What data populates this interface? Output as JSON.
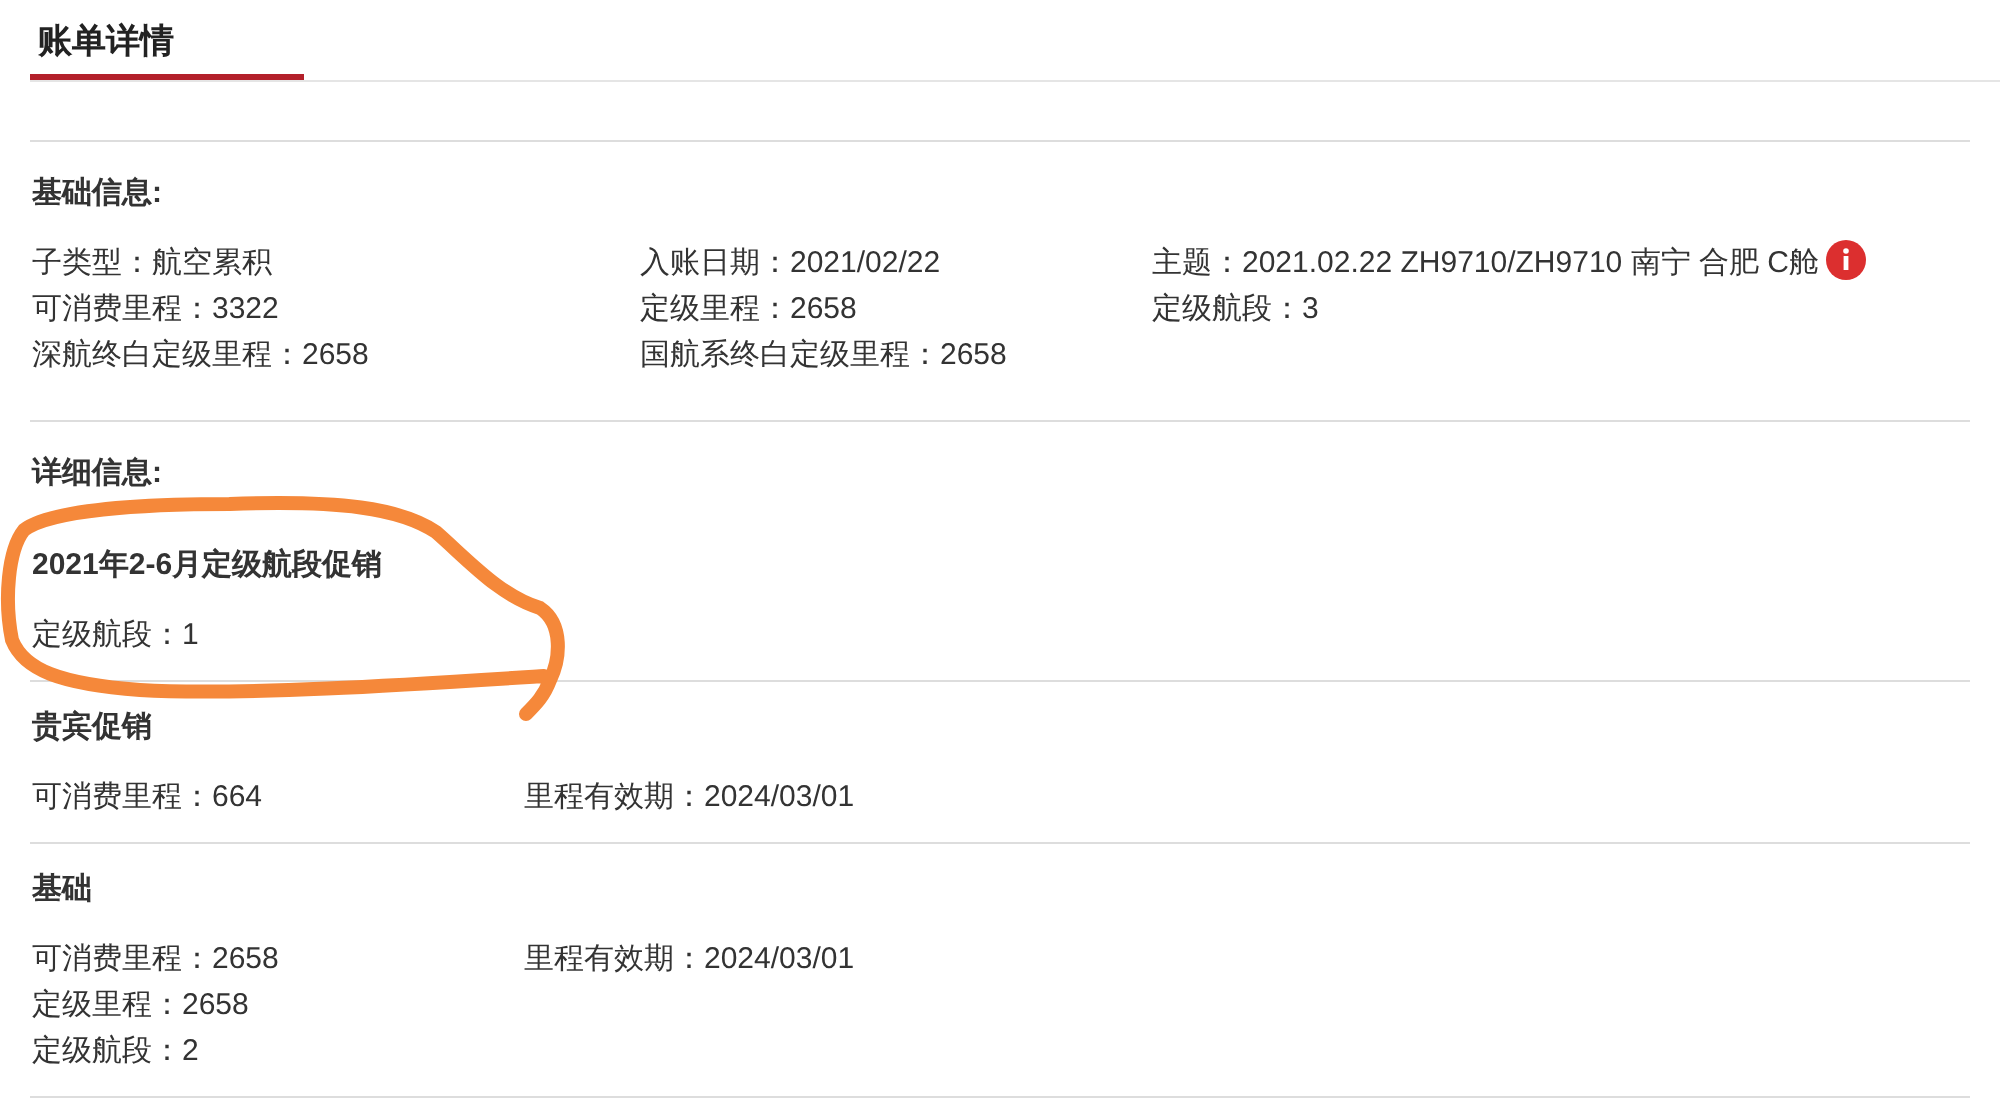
{
  "tab": {
    "label": "账单详情",
    "selected": true
  },
  "basic_info": {
    "heading": "基础信息:",
    "columns": [
      {
        "lines": [
          "子类型：航空累积",
          "可消费里程：3322",
          "深航终白定级里程：2658"
        ]
      },
      {
        "lines": [
          "入账日期：2021/02/22",
          "定级里程：2658",
          "国航系终白定级里程：2658"
        ]
      },
      {
        "lines": [
          "主题：2021.02.22 ZH9710/ZH9710 南宁 合肥 C舱",
          "定级航段：3"
        ]
      }
    ]
  },
  "details": {
    "heading": "详细信息:",
    "sections": [
      {
        "title": "2021年2-6月定级航段促销",
        "columns": [
          {
            "lines": [
              "定级航段：1"
            ]
          }
        ]
      },
      {
        "title": "贵宾促销",
        "columns": [
          {
            "lines": [
              "可消费里程：664"
            ]
          },
          {
            "lines": [
              "里程有效期：2024/03/01"
            ]
          }
        ]
      },
      {
        "title": "基础",
        "columns": [
          {
            "lines": [
              "可消费里程：2658",
              "定级里程：2658",
              "定级航段：2"
            ]
          },
          {
            "lines": [
              "里程有效期：2024/03/01"
            ]
          }
        ]
      }
    ]
  }
}
